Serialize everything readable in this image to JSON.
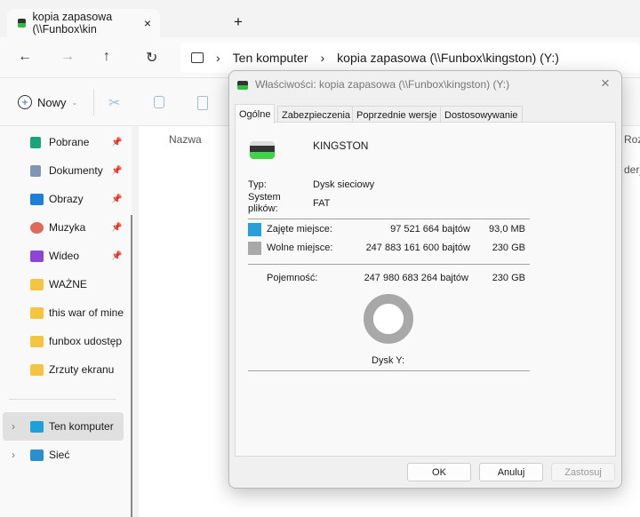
{
  "tab": {
    "title": "kopia zapasowa (\\\\Funbox\\kin",
    "close": "×",
    "new": "+"
  },
  "nav": {
    "back": "←",
    "forward": "→",
    "up": "↑",
    "refresh": "↻"
  },
  "address": {
    "crumbs": [
      "Ten komputer",
      "kopia zapasowa (\\\\Funbox\\kingston) (Y:)"
    ]
  },
  "toolbar": {
    "new_label": "Nowy"
  },
  "sidebar": {
    "items": [
      {
        "label": "Pobrane",
        "icon": "download-icon",
        "color": "#1aa37a",
        "pinned": true
      },
      {
        "label": "Dokumenty",
        "icon": "documents-icon",
        "color": "#7f97b5",
        "pinned": true
      },
      {
        "label": "Obrazy",
        "icon": "pictures-icon",
        "color": "#1e7fd6",
        "pinned": true
      },
      {
        "label": "Muzyka",
        "icon": "music-icon",
        "color": "#e06a5a",
        "pinned": true
      },
      {
        "label": "Wideo",
        "icon": "video-icon",
        "color": "#8e44d6",
        "pinned": true
      },
      {
        "label": "WAŻNE",
        "icon": "folder-icon",
        "color": "#f5c542"
      },
      {
        "label": "this war of mine",
        "icon": "folder-icon",
        "color": "#f5c542"
      },
      {
        "label": "funbox udostęp",
        "icon": "folder-icon",
        "color": "#f5c542"
      },
      {
        "label": "Zrzuty ekranu",
        "icon": "folder-icon",
        "color": "#f5c542"
      }
    ],
    "roots": [
      {
        "label": "Ten komputer",
        "selected": true
      },
      {
        "label": "Sieć"
      }
    ]
  },
  "content": {
    "col_name": "Nazwa",
    "col_size": "Roz",
    "partial_item": "der_"
  },
  "dialog": {
    "title": "Właściwości: kopia zapasowa (\\\\Funbox\\kingston) (Y:)",
    "tabs": [
      "Ogólne",
      "Zabezpieczenia",
      "Poprzednie wersje",
      "Dostosowywanie"
    ],
    "name": "KINGSTON",
    "type_label": "Typ:",
    "type_value": "Dysk sieciowy",
    "fs_label": "System plików:",
    "fs_value": "FAT",
    "used_label": "Zajęte miejsce:",
    "used_bytes": "97 521 664 bajtów",
    "used_human": "93,0 MB",
    "used_color": "#26a0da",
    "free_label": "Wolne miejsce:",
    "free_bytes": "247 883 161 600 bajtów",
    "free_human": "230 GB",
    "free_color": "#a8a8a8",
    "cap_label": "Pojemność:",
    "cap_bytes": "247 980 683 264 bajtów",
    "cap_human": "230 GB",
    "used_fraction": 0.0004,
    "drive_label": "Dysk Y:",
    "ok": "OK",
    "cancel": "Anuluj",
    "apply": "Zastosuj"
  }
}
